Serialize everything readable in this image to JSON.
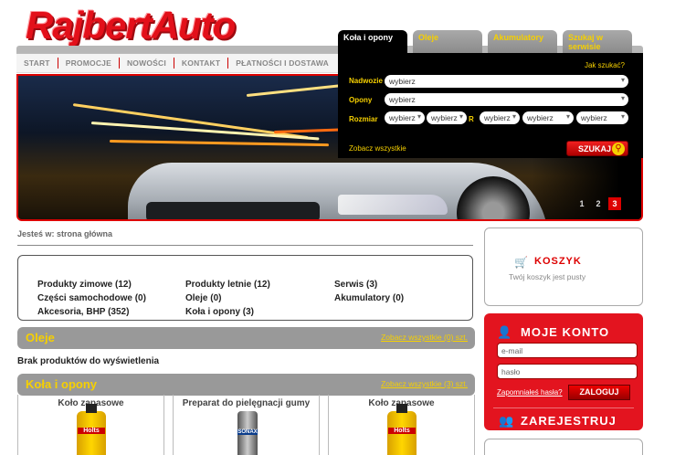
{
  "logo": {
    "text": "RajbertAuto"
  },
  "nav": {
    "items": [
      "START",
      "PROMOCJE",
      "NOWOŚCI",
      "KONTAKT",
      "PŁATNOŚCI I DOSTAWA"
    ]
  },
  "search": {
    "tabs": [
      "Koła i opony",
      "Oleje",
      "Akumulatory",
      "Szukaj w serwisie"
    ],
    "help": "Jak szukać?",
    "labels": {
      "nadwozie": "Nadwozie",
      "opony": "Opony",
      "rozmiar": "Rozmiar",
      "r": "R"
    },
    "placeholder": "wybierz",
    "see_all": "Zobacz wszystkie",
    "button": "SZUKAJ"
  },
  "slider": {
    "pages": [
      "1",
      "2",
      "3"
    ],
    "active": 3
  },
  "breadcrumb": "Jesteś w: strona główna",
  "categories": [
    "Produkty zimowe (12)",
    "Produkty letnie (12)",
    "Serwis (3)",
    "Części samochodowe (0)",
    "Oleje (0)",
    "Akumulatory (0)",
    "Akcesoria, BHP (352)",
    "Koła i opony (3)"
  ],
  "sections": {
    "oleje": {
      "title": "Oleje",
      "link": "Zobacz wszystkie (0) szt.",
      "empty": "Brak produktów do wyświetlenia"
    },
    "kola": {
      "title": "Koła i opony",
      "link": "Zobacz wszystkie (3) szt."
    }
  },
  "products": [
    {
      "name": "Koło zapasowe",
      "brand": "Holts"
    },
    {
      "name": "Preparat do pielęgnacji gumy",
      "brand": "SONAX"
    },
    {
      "name": "Koło zapasowe",
      "brand": "Holts"
    }
  ],
  "cart": {
    "title": "KOSZYK",
    "message": "Twój koszyk jest pusty"
  },
  "account": {
    "title": "MOJE KONTO",
    "email_placeholder": "e-mail",
    "password_placeholder": "hasło",
    "forgot": "Zapomniałeś hasła?",
    "login": "ZALOGUJ",
    "register": "ZAREJESTRUJ"
  },
  "colors": {
    "brand_red": "#e3141f",
    "accent_yellow": "#f6d000",
    "panel_black": "#000000",
    "header_gray": "#999999"
  }
}
